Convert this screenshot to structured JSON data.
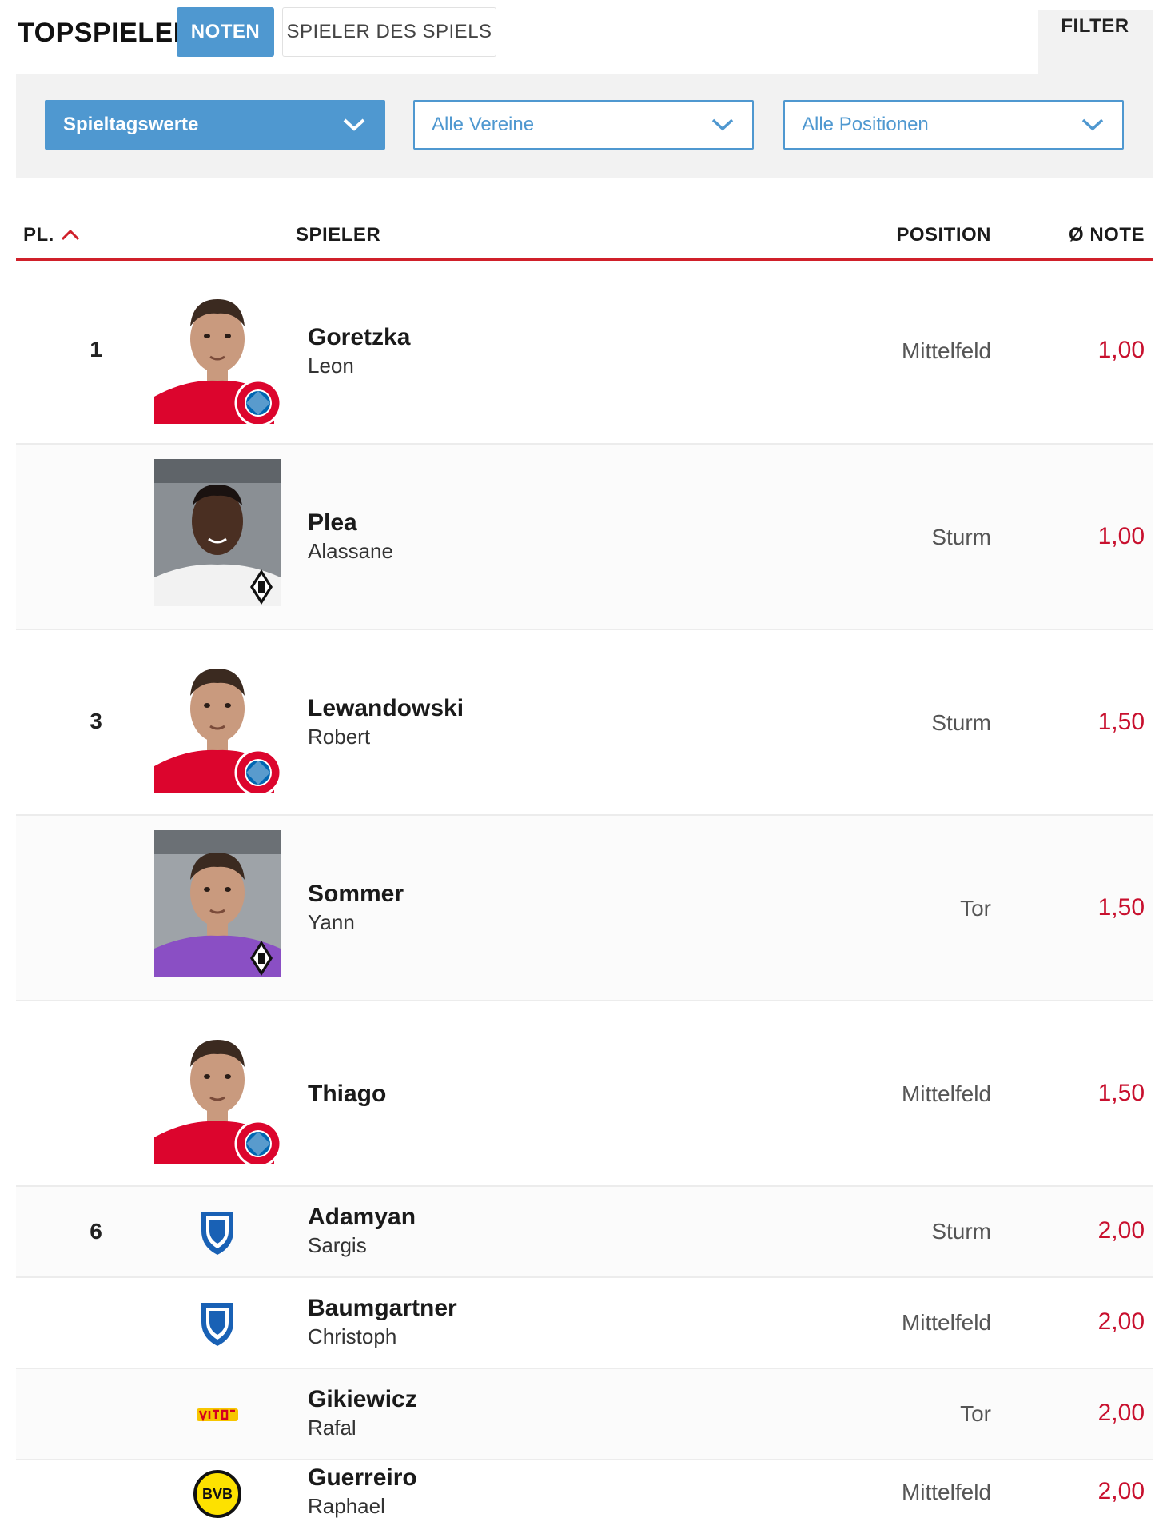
{
  "header": {
    "title": "TOPSPIELER",
    "tabs": [
      {
        "label": "NOTEN",
        "active": true
      },
      {
        "label": "SPIELER DES SPIELS",
        "active": false
      }
    ],
    "filter_label": "FILTER"
  },
  "filters": {
    "matchday": "Spieltagswerte",
    "club": "Alle Vereine",
    "position": "Alle Positionen"
  },
  "columns": {
    "rank": "PL.",
    "player": "SPIELER",
    "position": "POSITION",
    "grade": "Ø NOTE"
  },
  "colors": {
    "accent_blue": "#4f98d0",
    "grade_red": "#c8102e",
    "header_rule": "#d0202a"
  },
  "players": [
    {
      "rank": "1",
      "last": "Goretzka",
      "first": "Leon",
      "position": "Mittelfeld",
      "grade": "1,00",
      "club": "bayern-crest-icon"
    },
    {
      "rank": "",
      "last": "Plea",
      "first": "Alassane",
      "position": "Sturm",
      "grade": "1,00",
      "club": "gladbach-crest-icon"
    },
    {
      "rank": "3",
      "last": "Lewandowski",
      "first": "Robert",
      "position": "Sturm",
      "grade": "1,50",
      "club": "bayern-crest-icon"
    },
    {
      "rank": "",
      "last": "Sommer",
      "first": "Yann",
      "position": "Tor",
      "grade": "1,50",
      "club": "gladbach-crest-icon"
    },
    {
      "rank": "",
      "last": "Thiago",
      "first": "",
      "position": "Mittelfeld",
      "grade": "1,50",
      "club": "bayern-crest-icon"
    },
    {
      "rank": "6",
      "last": "Adamyan",
      "first": "Sargis",
      "position": "Sturm",
      "grade": "2,00",
      "club": "hoffenheim-crest-icon"
    },
    {
      "rank": "",
      "last": "Baumgartner",
      "first": "Christoph",
      "position": "Mittelfeld",
      "grade": "2,00",
      "club": "hoffenheim-crest-icon"
    },
    {
      "rank": "",
      "last": "Gikiewicz",
      "first": "Rafal",
      "position": "Tor",
      "grade": "2,00",
      "club": "union-crest-icon"
    },
    {
      "rank": "",
      "last": "Guerreiro",
      "first": "Raphael",
      "position": "Mittelfeld",
      "grade": "2,00",
      "club": "bvb-crest-icon"
    }
  ]
}
